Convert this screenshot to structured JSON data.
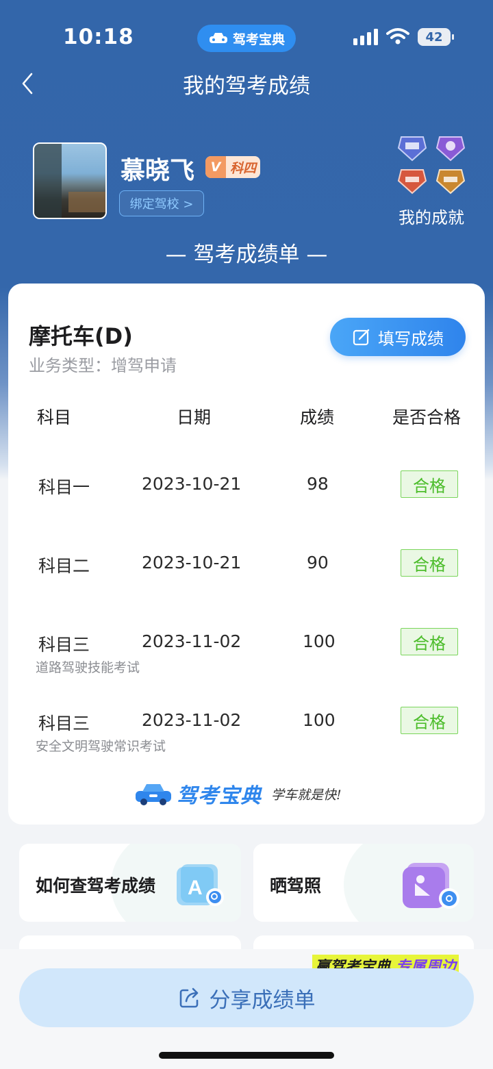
{
  "status_bar": {
    "time": "10:18",
    "app_name": "驾考宝典",
    "battery": "42"
  },
  "header": {
    "title": "我的驾考成绩"
  },
  "profile": {
    "name": "慕晓飞",
    "vip_v": "V",
    "vip_level": "科四",
    "bind_school": "绑定驾校 >",
    "achievements_label": "我的成就"
  },
  "section_title": "— 驾考成绩单 —",
  "card": {
    "license_type": "摩托车(D)",
    "business_type": "业务类型：增驾申请",
    "fill_button": "填写成绩",
    "columns": {
      "subject": "科目",
      "date": "日期",
      "score": "成绩",
      "pass": "是否合格"
    },
    "rows": [
      {
        "subject": "科目一",
        "date": "2023-10-21",
        "score": "98",
        "pass": "合格",
        "sub": ""
      },
      {
        "subject": "科目二",
        "date": "2023-10-21",
        "score": "90",
        "pass": "合格",
        "sub": ""
      },
      {
        "subject": "科目三",
        "date": "2023-11-02",
        "score": "100",
        "pass": "合格",
        "sub": "道路驾驶技能考试"
      },
      {
        "subject": "科目三",
        "date": "2023-11-02",
        "score": "100",
        "pass": "合格",
        "sub": "安全文明驾驶常识考试"
      }
    ],
    "brand_name": "驾考宝典",
    "brand_slogan": "学车就是快!"
  },
  "tiles": [
    {
      "label": "如何查驾考成绩",
      "icon": "search-document-icon"
    },
    {
      "label": "晒驾照",
      "icon": "photo-share-icon"
    }
  ],
  "promo": {
    "part1": "赢驾考宝典",
    "part2": "专属周边"
  },
  "share_button": "分享成绩单",
  "colors": {
    "primary": "#3366aa",
    "accent": "#2f84ec",
    "pass_green": "#4cbd2b"
  }
}
